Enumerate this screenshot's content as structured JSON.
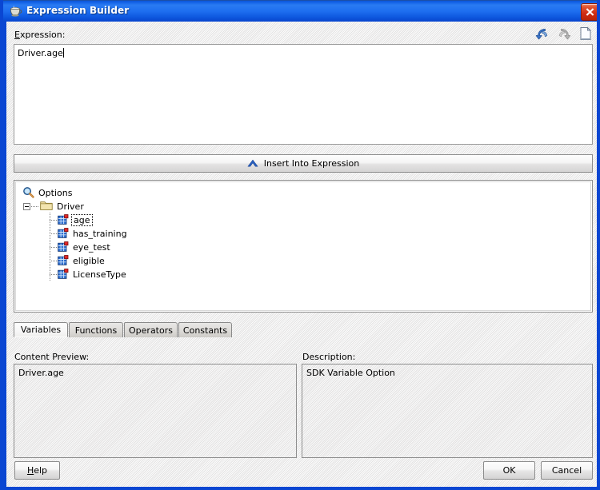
{
  "window": {
    "title": "Expression Builder",
    "icon": "coffee-cup-icon",
    "close_label": "Close",
    "titlebar_color": "#1565e8",
    "close_color": "#cf2a12"
  },
  "toolbar": {
    "undo": {
      "name": "undo-icon",
      "title": "Undo",
      "enabled": true
    },
    "redo": {
      "name": "redo-icon",
      "title": "Redo",
      "enabled": false
    },
    "clear": {
      "name": "new-document-icon",
      "title": "Clear",
      "enabled": true
    }
  },
  "expression": {
    "label": "Expression:",
    "label_mnemonic": "E",
    "label_rest": "xpression:",
    "value": "Driver.age"
  },
  "insert_button": {
    "label": "Insert Into Expression",
    "icon": "chevron-up-icon"
  },
  "tree": {
    "root": {
      "label": "Options",
      "icon": "magnifier-icon"
    },
    "folder": {
      "label": "Driver",
      "icon": "folder-icon",
      "expanded": true
    },
    "items": [
      {
        "label": "age",
        "icon": "variable-grid-icon",
        "focused": true
      },
      {
        "label": "has_training",
        "icon": "variable-grid-icon",
        "focused": false
      },
      {
        "label": "eye_test",
        "icon": "variable-grid-icon",
        "focused": false
      },
      {
        "label": "eligible",
        "icon": "variable-grid-icon",
        "focused": false
      },
      {
        "label": "LicenseType",
        "icon": "variable-grid-icon",
        "focused": false
      }
    ]
  },
  "tabs": {
    "selected": "Variables",
    "items": [
      {
        "label": "Variables",
        "active": true
      },
      {
        "label": "Functions",
        "active": false
      },
      {
        "label": "Operators",
        "active": false
      },
      {
        "label": "Constants",
        "active": false
      }
    ]
  },
  "content_preview": {
    "label": "Content Preview:",
    "value": "Driver.age"
  },
  "description": {
    "label": "Description:",
    "value": "SDK Variable Option"
  },
  "buttons": {
    "help": {
      "label": "Help",
      "mnemonic": "H",
      "rest": "elp"
    },
    "ok": {
      "label": "OK"
    },
    "cancel": {
      "label": "Cancel"
    }
  }
}
